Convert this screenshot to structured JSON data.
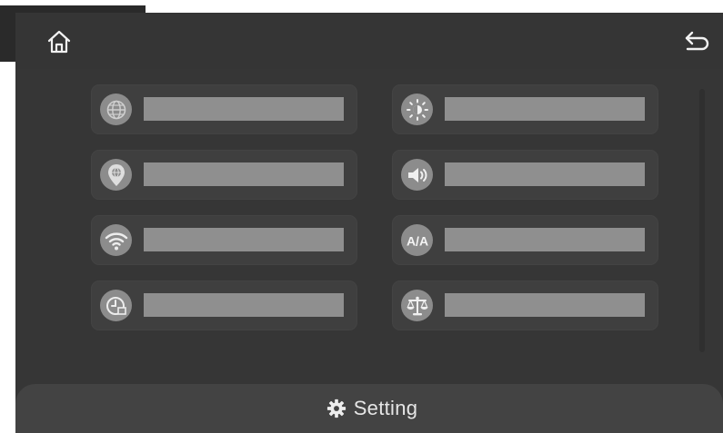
{
  "colors": {
    "screen_bg": "#363636",
    "tile_bg": "#3f3f3f",
    "icon_circle": "#8c8c8c",
    "placeholder_bar": "#8f8f8f",
    "footer_bg": "#434343",
    "text": "#e6e6e6"
  },
  "topbar": {
    "home_icon": "home-icon",
    "back_icon": "back-arrow-icon"
  },
  "menu": {
    "items": [
      {
        "icon": "globe-icon"
      },
      {
        "icon": "location-pin-icon"
      },
      {
        "icon": "wifi-icon"
      },
      {
        "icon": "clock-icon"
      },
      {
        "icon": "brightness-icon"
      },
      {
        "icon": "volume-icon"
      },
      {
        "icon": "font-size-icon",
        "icon_text": "A/A"
      },
      {
        "icon": "scale-icon"
      }
    ]
  },
  "footer": {
    "icon": "gear-icon",
    "label": "Setting"
  }
}
